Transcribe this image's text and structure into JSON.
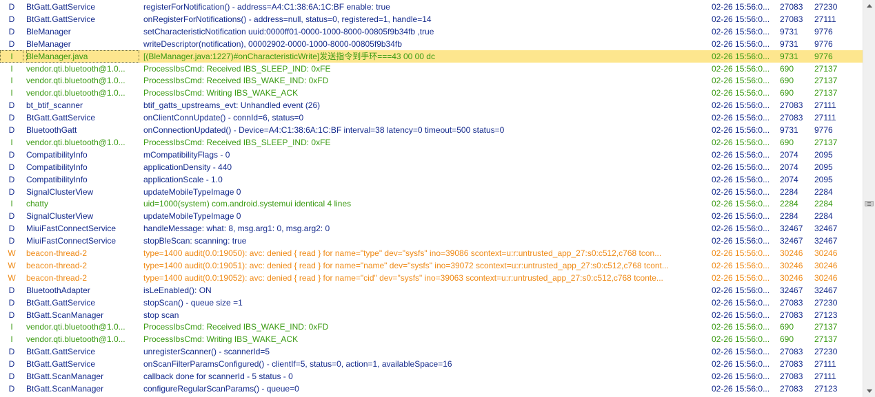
{
  "colors": {
    "debug": "#142a8c",
    "info": "#3a9a12",
    "warn": "#ef8a16",
    "selected_background": "#fde68e"
  },
  "log": {
    "rows": [
      {
        "level": "D",
        "tag": "BtGatt.GattService",
        "message": "registerForNotification() - address=A4:C1:38:6A:1C:BF enable: true",
        "time": "02-26 15:56:0...",
        "pid": "27083",
        "tid": "27230"
      },
      {
        "level": "D",
        "tag": "BtGatt.GattService",
        "message": "onRegisterForNotifications() - address=null, status=0, registered=1, handle=14",
        "time": "02-26 15:56:0...",
        "pid": "27083",
        "tid": "27111"
      },
      {
        "level": "D",
        "tag": "BleManager",
        "message": "setCharacteristicNotification uuid:0000ff01-0000-1000-8000-00805f9b34fb ,true",
        "time": "02-26 15:56:0...",
        "pid": "9731",
        "tid": "9776"
      },
      {
        "level": "D",
        "tag": "BleManager",
        "message": "writeDescriptor(notification), 00002902-0000-1000-8000-00805f9b34fb",
        "time": "02-26 15:56:0...",
        "pid": "9731",
        "tid": "9776"
      },
      {
        "level": "I",
        "tag": "BleManager.java",
        "message": "[(BleManager.java:1227)#onCharacteristicWrite]发送指令到手环===43 00 00 dc",
        "time": "02-26 15:56:0...",
        "pid": "9731",
        "tid": "9776",
        "selected": true
      },
      {
        "level": "I",
        "tag": "vendor.qti.bluetooth@1.0...",
        "message": "ProcessIbsCmd: Received IBS_SLEEP_IND: 0xFE",
        "time": "02-26 15:56:0...",
        "pid": "690",
        "tid": "27137"
      },
      {
        "level": "I",
        "tag": "vendor.qti.bluetooth@1.0...",
        "message": "ProcessIbsCmd: Received IBS_WAKE_IND: 0xFD",
        "time": "02-26 15:56:0...",
        "pid": "690",
        "tid": "27137"
      },
      {
        "level": "I",
        "tag": "vendor.qti.bluetooth@1.0...",
        "message": "ProcessIbsCmd: Writing IBS_WAKE_ACK",
        "time": "02-26 15:56:0...",
        "pid": "690",
        "tid": "27137"
      },
      {
        "level": "D",
        "tag": "bt_btif_scanner",
        "message": "btif_gatts_upstreams_evt: Unhandled event (26)",
        "time": "02-26 15:56:0...",
        "pid": "27083",
        "tid": "27111"
      },
      {
        "level": "D",
        "tag": "BtGatt.GattService",
        "message": "onClientConnUpdate() - connId=6, status=0",
        "time": "02-26 15:56:0...",
        "pid": "27083",
        "tid": "27111"
      },
      {
        "level": "D",
        "tag": "BluetoothGatt",
        "message": "onConnectionUpdated() - Device=A4:C1:38:6A:1C:BF interval=38 latency=0 timeout=500 status=0",
        "time": "02-26 15:56:0...",
        "pid": "9731",
        "tid": "9776"
      },
      {
        "level": "I",
        "tag": "vendor.qti.bluetooth@1.0...",
        "message": "ProcessIbsCmd: Received IBS_SLEEP_IND: 0xFE",
        "time": "02-26 15:56:0...",
        "pid": "690",
        "tid": "27137"
      },
      {
        "level": "D",
        "tag": "CompatibilityInfo",
        "message": "mCompatibilityFlags - 0",
        "time": "02-26 15:56:0...",
        "pid": "2074",
        "tid": "2095"
      },
      {
        "level": "D",
        "tag": "CompatibilityInfo",
        "message": "applicationDensity - 440",
        "time": "02-26 15:56:0...",
        "pid": "2074",
        "tid": "2095"
      },
      {
        "level": "D",
        "tag": "CompatibilityInfo",
        "message": "applicationScale - 1.0",
        "time": "02-26 15:56:0...",
        "pid": "2074",
        "tid": "2095"
      },
      {
        "level": "D",
        "tag": "SignalClusterView",
        "message": "updateMobileTypeImage 0",
        "time": "02-26 15:56:0...",
        "pid": "2284",
        "tid": "2284"
      },
      {
        "level": "I",
        "tag": "chatty",
        "message": "uid=1000(system) com.android.systemui identical 4 lines",
        "time": "02-26 15:56:0...",
        "pid": "2284",
        "tid": "2284"
      },
      {
        "level": "D",
        "tag": "SignalClusterView",
        "message": "updateMobileTypeImage 0",
        "time": "02-26 15:56:0...",
        "pid": "2284",
        "tid": "2284"
      },
      {
        "level": "D",
        "tag": "MiuiFastConnectService",
        "message": "handleMessage: what: 8, msg.arg1: 0, msg.arg2: 0",
        "time": "02-26 15:56:0...",
        "pid": "32467",
        "tid": "32467"
      },
      {
        "level": "D",
        "tag": "MiuiFastConnectService",
        "message": "stopBleScan: scanning: true",
        "time": "02-26 15:56:0...",
        "pid": "32467",
        "tid": "32467"
      },
      {
        "level": "W",
        "tag": "beacon-thread-2",
        "message": "type=1400 audit(0.0:19050): avc: denied { read } for name=\"type\" dev=\"sysfs\" ino=39086 scontext=u:r:untrusted_app_27:s0:c512,c768 tcon...",
        "time": "02-26 15:56:0...",
        "pid": "30246",
        "tid": "30246"
      },
      {
        "level": "W",
        "tag": "beacon-thread-2",
        "message": "type=1400 audit(0.0:19051): avc: denied { read } for name=\"name\" dev=\"sysfs\" ino=39072 scontext=u:r:untrusted_app_27:s0:c512,c768 tcont...",
        "time": "02-26 15:56:0...",
        "pid": "30246",
        "tid": "30246"
      },
      {
        "level": "W",
        "tag": "beacon-thread-2",
        "message": "type=1400 audit(0.0:19052): avc: denied { read } for name=\"cid\" dev=\"sysfs\" ino=39063 scontext=u:r:untrusted_app_27:s0:c512,c768 tconte...",
        "time": "02-26 15:56:0...",
        "pid": "30246",
        "tid": "30246"
      },
      {
        "level": "D",
        "tag": "BluetoothAdapter",
        "message": "isLeEnabled(): ON",
        "time": "02-26 15:56:0...",
        "pid": "32467",
        "tid": "32467"
      },
      {
        "level": "D",
        "tag": "BtGatt.GattService",
        "message": "stopScan() - queue size =1",
        "time": "02-26 15:56:0...",
        "pid": "27083",
        "tid": "27230"
      },
      {
        "level": "D",
        "tag": "BtGatt.ScanManager",
        "message": "stop scan",
        "time": "02-26 15:56:0...",
        "pid": "27083",
        "tid": "27123"
      },
      {
        "level": "I",
        "tag": "vendor.qti.bluetooth@1.0...",
        "message": "ProcessIbsCmd: Received IBS_WAKE_IND: 0xFD",
        "time": "02-26 15:56:0...",
        "pid": "690",
        "tid": "27137"
      },
      {
        "level": "I",
        "tag": "vendor.qti.bluetooth@1.0...",
        "message": "ProcessIbsCmd: Writing IBS_WAKE_ACK",
        "time": "02-26 15:56:0...",
        "pid": "690",
        "tid": "27137"
      },
      {
        "level": "D",
        "tag": "BtGatt.GattService",
        "message": "unregisterScanner() - scannerId=5",
        "time": "02-26 15:56:0...",
        "pid": "27083",
        "tid": "27230"
      },
      {
        "level": "D",
        "tag": "BtGatt.GattService",
        "message": "onScanFilterParamsConfigured() - clientIf=5, status=0, action=1, availableSpace=16",
        "time": "02-26 15:56:0...",
        "pid": "27083",
        "tid": "27111"
      },
      {
        "level": "D",
        "tag": "BtGatt.ScanManager",
        "message": "callback done for scannerId - 5 status - 0",
        "time": "02-26 15:56:0...",
        "pid": "27083",
        "tid": "27111"
      },
      {
        "level": "D",
        "tag": "BtGatt.ScanManager",
        "message": "configureRegularScanParams() - queue=0",
        "time": "02-26 15:56:0...",
        "pid": "27083",
        "tid": "27123"
      }
    ]
  },
  "scrollbar": {
    "up_icon": "arrow-up-icon",
    "down_icon": "arrow-down-icon",
    "position_fraction": 0.5
  }
}
